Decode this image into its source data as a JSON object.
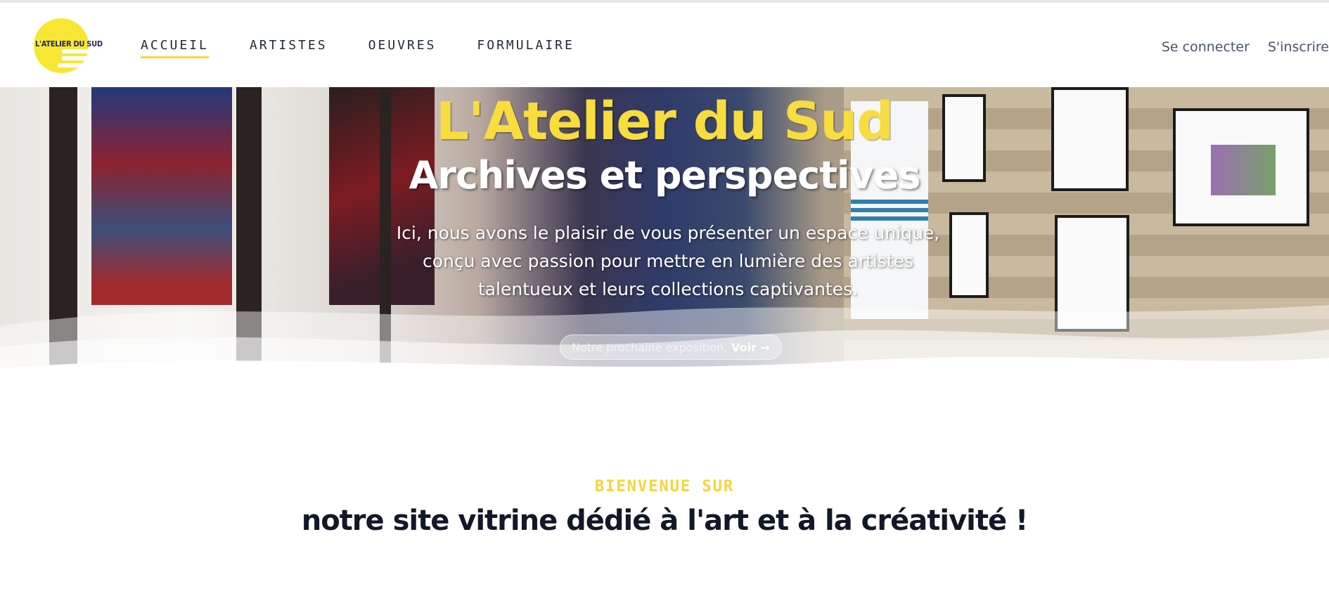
{
  "header": {
    "logo_text": "L'ATELIER DU SUD",
    "nav": [
      {
        "label": "Accueil",
        "active": true
      },
      {
        "label": "Artistes",
        "active": false
      },
      {
        "label": "Oeuvres",
        "active": false
      },
      {
        "label": "Formulaire",
        "active": false
      }
    ],
    "auth": {
      "login_label": "Se connecter",
      "register_label": "S'inscrire"
    }
  },
  "hero": {
    "title": "L'Atelier du Sud",
    "subtitle": "Archives et perspectives",
    "description": "Ici, nous avons le plaisir de vous présenter un espace unique, conçu avec passion pour mettre en lumière des artistes talentueux et leurs collections captivantes.",
    "cta_text": "Notre prochaine exposition.",
    "cta_link": "Voir →"
  },
  "intro": {
    "kicker": "Bienvenue sur",
    "title": "notre site vitrine dédié à l'art et à la créativité !"
  },
  "colors": {
    "accent_yellow": "#f7d73a",
    "text_dark": "#111827",
    "text_muted": "#475569"
  }
}
